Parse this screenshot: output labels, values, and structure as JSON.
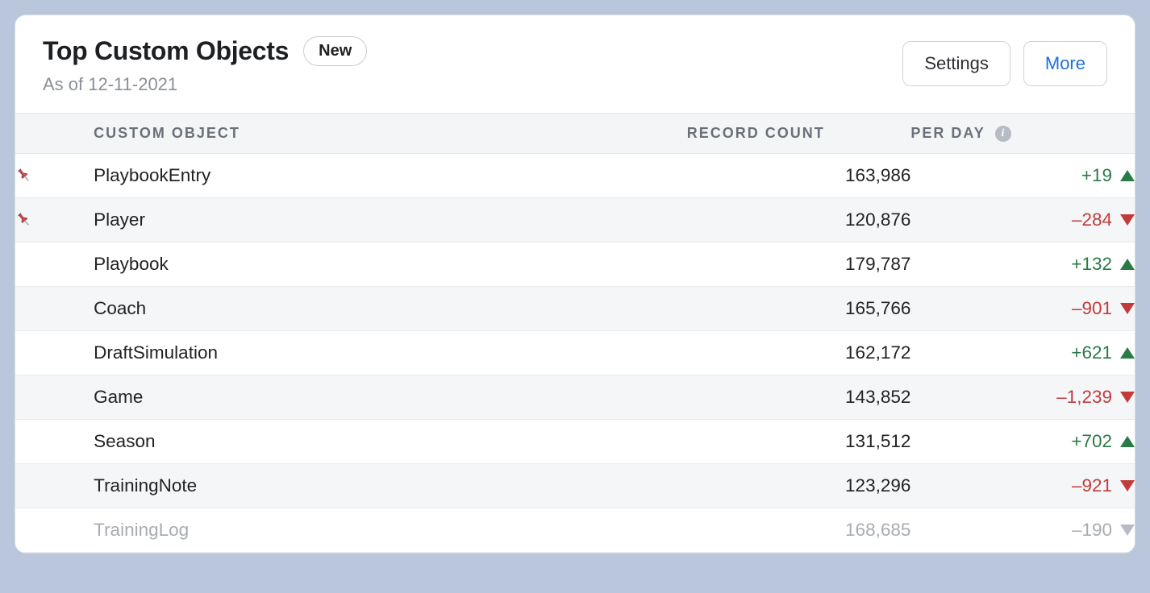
{
  "header": {
    "title": "Top Custom Objects",
    "badge": "New",
    "subtitle": "As of 12-11-2021",
    "settings_label": "Settings",
    "more_label": "More"
  },
  "columns": {
    "custom_object": "CUSTOM OBJECT",
    "record_count": "RECORD COUNT",
    "per_day": "PER DAY"
  },
  "rows": [
    {
      "pinned": true,
      "name": "PlaybookEntry",
      "count": "163,986",
      "delta": "+19",
      "trend": "up",
      "faded": false
    },
    {
      "pinned": true,
      "name": "Player",
      "count": "120,876",
      "delta": "–284",
      "trend": "down",
      "faded": false
    },
    {
      "pinned": false,
      "name": "Playbook",
      "count": "179,787",
      "delta": "+132",
      "trend": "up",
      "faded": false
    },
    {
      "pinned": false,
      "name": "Coach",
      "count": "165,766",
      "delta": "–901",
      "trend": "down",
      "faded": false
    },
    {
      "pinned": false,
      "name": "DraftSimulation",
      "count": "162,172",
      "delta": "+621",
      "trend": "up",
      "faded": false
    },
    {
      "pinned": false,
      "name": "Game",
      "count": "143,852",
      "delta": "–1,239",
      "trend": "down",
      "faded": false
    },
    {
      "pinned": false,
      "name": "Season",
      "count": "131,512",
      "delta": "+702",
      "trend": "up",
      "faded": false
    },
    {
      "pinned": false,
      "name": "TrainingNote",
      "count": "123,296",
      "delta": "–921",
      "trend": "down",
      "faded": false
    },
    {
      "pinned": false,
      "name": "TrainingLog",
      "count": "168,685",
      "delta": "–190",
      "trend": "neutral",
      "faded": true
    }
  ]
}
